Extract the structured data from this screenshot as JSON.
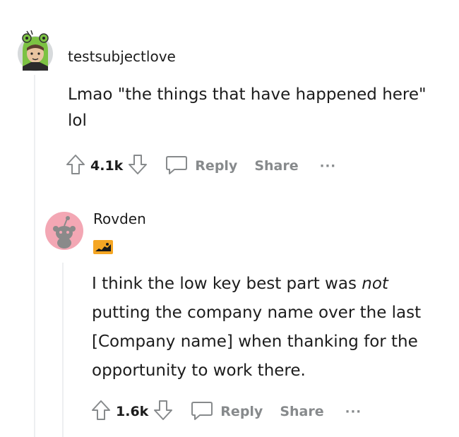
{
  "comment1": {
    "username": "testsubjectlove",
    "text": "Lmao \"the things that have happened here\" lol",
    "score": "4.1k",
    "reply_label": "Reply",
    "share_label": "Share",
    "more_label": "···"
  },
  "comment2": {
    "username": "Rovden",
    "text_before": "I think the low key best part was ",
    "text_emphasis": "not",
    "text_after": " putting the company name over the last [Company name] when thanking for the opportunity to work there.",
    "score": "1.6k",
    "reply_label": "Reply",
    "share_label": "Share",
    "more_label": "···"
  },
  "colors": {
    "action_gray": "#878a8c",
    "thread_line": "#edeff1",
    "avatar2_bg": "#f3a7b4",
    "flair_bg": "#f5a623"
  },
  "icons": [
    "avatar",
    "upvote-icon",
    "downvote-icon",
    "comment-bubble-icon",
    "snoo-avatar-icon",
    "flair-icon"
  ]
}
